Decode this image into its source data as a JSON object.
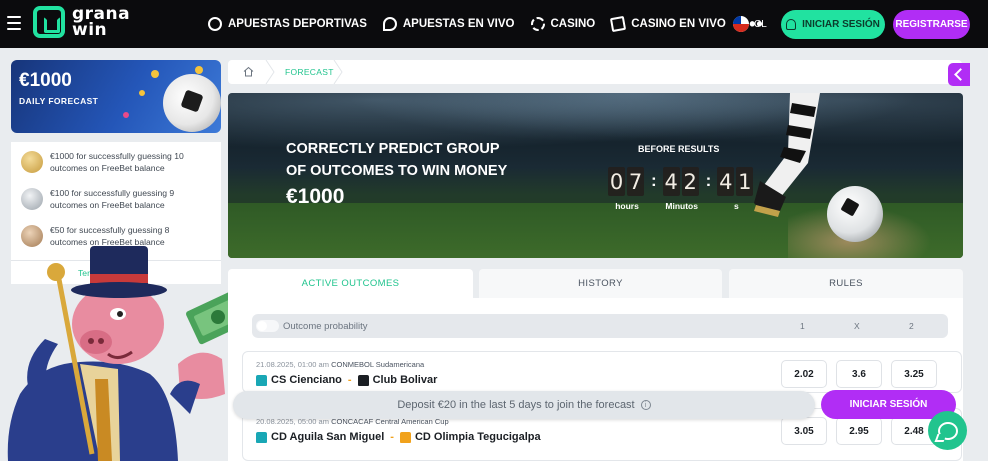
{
  "header": {
    "logo_line1": "grana",
    "logo_line2": "win",
    "nav": [
      {
        "label": "APUESTAS DEPORTIVAS",
        "icon": "soccer-ball-icon"
      },
      {
        "label": "APUESTAS EN VIVO",
        "icon": "live-icon"
      },
      {
        "label": "CASINO",
        "icon": "chip-icon"
      },
      {
        "label": "CASINO EN VIVO",
        "icon": "card-icon"
      }
    ],
    "more": "•••",
    "language": "CL",
    "login_label": "INICIAR SESIÓN",
    "register_label": "REGISTRARSE"
  },
  "promo": {
    "amount": "€1000",
    "label": "DAILY FORECAST"
  },
  "prizes": [
    {
      "text": "€1000 for successfully guessing 10 outcomes on FreeBet balance",
      "medal": "gold"
    },
    {
      "text": "€100 for successfully guessing 9 outcomes on FreeBet balance",
      "medal": "silver"
    },
    {
      "text": "€50 for successfully guessing 8 outcomes on FreeBet balance",
      "medal": "bronze"
    }
  ],
  "terms_label": "Term",
  "breadcrumb": {
    "current": "FORECAST"
  },
  "hero": {
    "title": "CORRECTLY PREDICT GROUP OF OUTCOMES TO WIN MONEY",
    "amount": "€1000",
    "before_label": "BEFORE RESULTS",
    "timer": {
      "hours": [
        "0",
        "7"
      ],
      "minutes": [
        "4",
        "2"
      ],
      "seconds": [
        "4",
        "1"
      ],
      "hours_label": "hours",
      "minutes_label": "Minutos",
      "seconds_label": "s"
    }
  },
  "tabs": [
    {
      "label": "ACTIVE OUTCOMES",
      "active": true
    },
    {
      "label": "HISTORY",
      "active": false
    },
    {
      "label": "RULES",
      "active": false
    }
  ],
  "probability": {
    "label": "Outcome probability",
    "col1": "1",
    "colx": "X",
    "col2": "2"
  },
  "matches": [
    {
      "date": "21.08.2025, 01:00 am",
      "league": "CONMEBOL Sudamericana",
      "home": "CS Cienciano",
      "away": "Club Bolivar",
      "home_color": "#19a7b5",
      "away_color": "#1b1f24",
      "odds": [
        "2.02",
        "3.6",
        "3.25"
      ]
    },
    {
      "date": "20.08.2025, 05:00 am",
      "league": "CONCACAF Central American Cup",
      "home": "CD Aguila San Miguel",
      "away": "CD Olimpia Tegucigalpa",
      "home_color": "#19a7b5",
      "away_color": "#f1a21c",
      "odds": [
        "3.05",
        "2.95",
        "2.48"
      ]
    }
  ],
  "deposit_text": "Deposit €20 in the last 5 days to join the forecast",
  "login_cta": "INICIAR SESIÓN",
  "colors": {
    "accent_green": "#21e2a0",
    "accent_purple": "#b12df5",
    "header_bg": "#0b0b0d"
  }
}
